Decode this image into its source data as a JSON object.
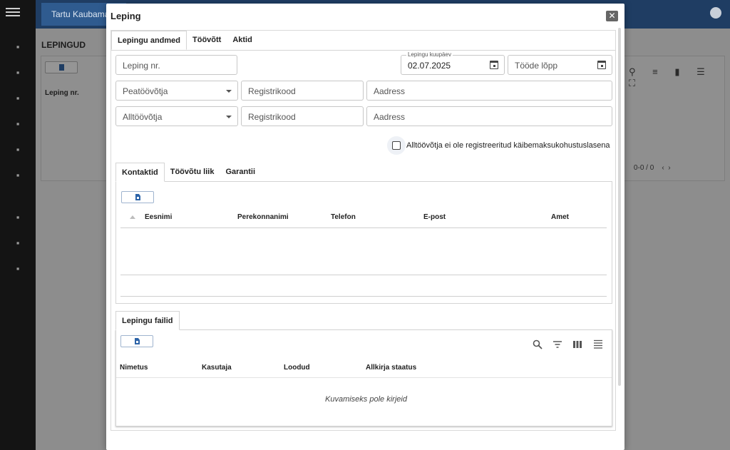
{
  "background": {
    "app_tab": "Tartu Kaubamaja",
    "section_title": "LEPINGUD",
    "table_column": "Leping nr.",
    "pager": "0-0 / 0"
  },
  "dialog": {
    "title": "Leping",
    "close_icon": "close-icon",
    "top_tabs": [
      "Lepingu andmed",
      "Töövõtt",
      "Aktid"
    ],
    "form": {
      "contract_no_placeholder": "Leping nr.",
      "contract_date_label": "Lepingu kuupäev",
      "contract_date_value": "02.07.2025",
      "work_end_placeholder": "Tööde lõpp",
      "main_contractor_placeholder": "Peatöövõtja",
      "main_reg_placeholder": "Registrikood",
      "main_address_placeholder": "Aadress",
      "sub_contractor_placeholder": "Alltöövõtja",
      "sub_reg_placeholder": "Registrikood",
      "sub_address_placeholder": "Aadress",
      "vat_checkbox_label": "Alltöövõtja ei ole registreeritud käibemaksukohustuslasena",
      "vat_checked": false
    },
    "contact_tabs": [
      "Kontaktid",
      "Töövõtu liik",
      "Garantii"
    ],
    "contacts_table": {
      "columns": [
        "Eesnimi",
        "Perekonnanimi",
        "Telefon",
        "E-post",
        "Amet"
      ]
    },
    "files_tab": "Lepingu failid",
    "files_table": {
      "columns": [
        "Nimetus",
        "Kasutaja",
        "Loodud",
        "Allkirja staatus"
      ],
      "empty_text": "Kuvamiseks pole kirjeid"
    }
  }
}
